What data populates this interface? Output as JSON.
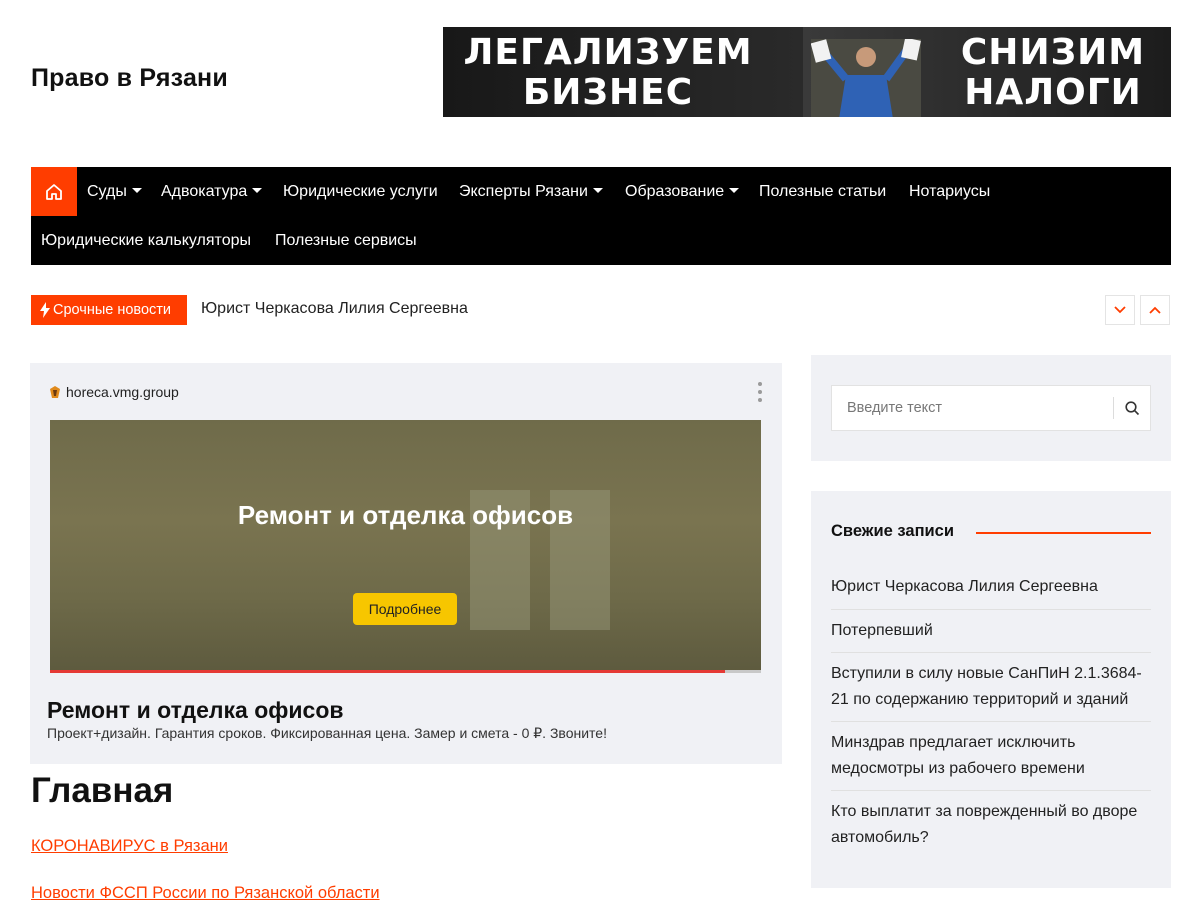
{
  "site": {
    "title": "Право в Рязани"
  },
  "banner": {
    "left_text": "ЛЕГАЛИЗУЕМ\nБИЗНЕС",
    "right_text": "СНИЗИМ\nНАЛОГИ"
  },
  "nav": {
    "home_icon": "home-icon",
    "items": [
      {
        "label": "Суды",
        "has_dropdown": true
      },
      {
        "label": "Адвокатура",
        "has_dropdown": true
      },
      {
        "label": "Юридические услуги",
        "has_dropdown": false
      },
      {
        "label": "Эксперты Рязани",
        "has_dropdown": true
      },
      {
        "label": "Образование",
        "has_dropdown": true
      },
      {
        "label": "Полезные статьи",
        "has_dropdown": false
      },
      {
        "label": "Нотариусы",
        "has_dropdown": false
      },
      {
        "label": "Юридические калькуляторы",
        "has_dropdown": false
      },
      {
        "label": "Полезные сервисы",
        "has_dropdown": false
      }
    ]
  },
  "ticker": {
    "label": "Срочные новости",
    "text": "Юрист Черкасова Лилия Сергеевна"
  },
  "ad": {
    "domain": "horeca.vmg.group",
    "image_heading": "Ремонт и отделка офисов",
    "button": "Подробнее",
    "headline": "Ремонт и отделка офисов",
    "description": "Проект+дизайн. Гарантия сроков. Фиксированная цена. Замер и смета - 0 ₽. Звоните!",
    "progress": 0.95
  },
  "main": {
    "heading": "Главная",
    "links": [
      "КОРОНАВИРУС в Рязани",
      "Новости ФССП России по Рязанской области"
    ]
  },
  "sidebar": {
    "search_placeholder": "Введите текст",
    "recent_title": "Свежие записи",
    "recent": [
      "Юрист Черкасова Лилия Сергеевна",
      "Потерпевший",
      "Вступили в силу новые СанПиН 2.1.3684-21 по содержанию территорий и зданий",
      "Минздрав предлагает исключить медосмотры из рабочего времени",
      "Кто выплатит за поврежденный во дворе автомобиль?"
    ]
  },
  "colors": {
    "accent": "#ff3d00",
    "nav_bg": "#000000",
    "widget_bg": "#f0f1f5",
    "ad_button": "#f7c600"
  }
}
